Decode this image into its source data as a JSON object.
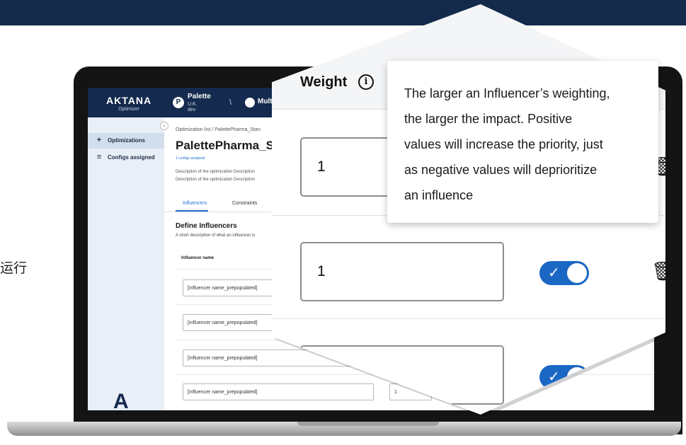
{
  "side_glyph": "运行",
  "app": {
    "brand": "AKTANA",
    "brand_sub": "Optimizer",
    "palette_title": "Palette",
    "palette_sub1": "U.K.",
    "palette_sub2": "dev",
    "separator": "\\",
    "multi_label": "Multi",
    "collapse": "‹"
  },
  "sidebar": {
    "items": [
      {
        "label": "Optimizations",
        "icon": "plus-icon",
        "glyph": "+"
      },
      {
        "label": "Configs assigned",
        "icon": "database-icon",
        "glyph": "≡"
      }
    ],
    "logo": "A"
  },
  "page": {
    "breadcrumb": "Optimization list  /  PalettePharma_Stan",
    "title": "PalettePharma_Sta",
    "configs_link": "1 configs assigned",
    "desc1": "Description of the optimization Description",
    "desc2": "Description of the optimization Description"
  },
  "tabs": [
    "Influencers",
    "Constraints"
  ],
  "section": {
    "title": "Define Influencers",
    "desc": "A short description of what an influencer is",
    "column_header": "Influencer name"
  },
  "influencers": [
    {
      "name": "[influencer name_prepopulated]"
    },
    {
      "name": "[influencer name_prepopulated]"
    },
    {
      "name": "[influencer name_prepopulated]"
    },
    {
      "name": "[influencer name_prepopulated]",
      "weight": "1"
    }
  ],
  "zoom": {
    "column_label": "Weight",
    "info_glyph": "i",
    "tooltip": [
      "The larger an Influencer’s weighting,",
      "the larger the impact. Positive",
      "values will increase the priority, just",
      "as negative values will deprioritize",
      "an influence"
    ],
    "rows": [
      {
        "weight": "1",
        "enabled": true
      },
      {
        "weight": "1",
        "enabled": true
      },
      {
        "weight": "",
        "enabled": true
      }
    ],
    "check_glyph": "✓",
    "trash_glyph": "🗑"
  }
}
